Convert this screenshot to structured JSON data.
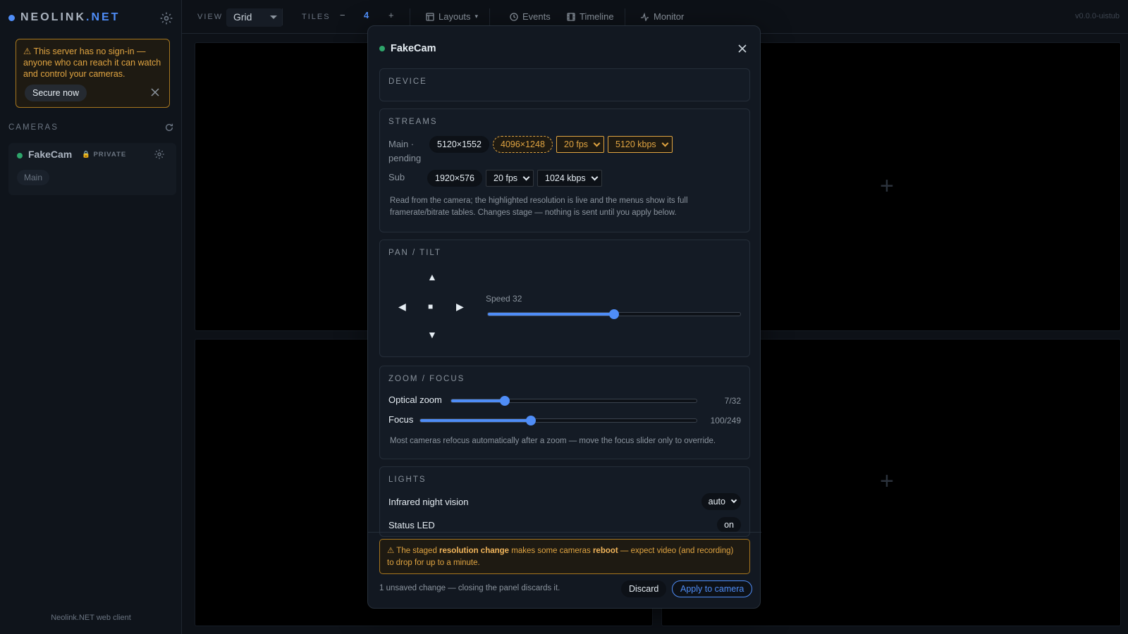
{
  "brand": {
    "name_a": "NEOLINK",
    "name_b": ".NET"
  },
  "sidebar": {
    "warning": {
      "text": "This server has no sign-in — anyone who can reach it can watch and control your cameras.",
      "secure_label": "Secure now"
    },
    "cameras_label": "CAMERAS",
    "camera": {
      "name": "FakeCam",
      "badge": "PRIVATE",
      "stream_chip": "Main"
    },
    "footer": "Neolink.NET web client"
  },
  "toolbar": {
    "view_label": "VIEW",
    "view_value": "Grid",
    "tiles_label": "TILES",
    "tiles_minus": "−",
    "tiles_count": "4",
    "tiles_plus": "+",
    "layouts": "Layouts",
    "events": "Events",
    "timeline": "Timeline",
    "monitor": "Monitor",
    "version": "v0.0.0-uistub"
  },
  "tiles": {
    "add_glyph": "+"
  },
  "modal": {
    "title": "FakeCam",
    "device_title": "DEVICE",
    "streams": {
      "title": "STREAMS",
      "main_label": "Main · pending",
      "main_res_live": "5120×1552",
      "main_res_staged": "4096×1248",
      "main_fps": "20 fps",
      "main_kbps": "5120 kbps",
      "sub_label": "Sub",
      "sub_res": "1920×576",
      "sub_fps": "20 fps",
      "sub_kbps": "1024 kbps",
      "note": "Read from the camera; the highlighted resolution is live and the menus show its full framerate/bitrate tables. Changes stage — nothing is sent until you apply below."
    },
    "pantilt": {
      "title": "PAN / TILT",
      "up": "▲",
      "down": "▼",
      "left": "◀",
      "right": "▶",
      "stop": "■",
      "speed_label": "Speed 32",
      "speed_value": 32,
      "speed_max": 64
    },
    "zoom": {
      "title": "ZOOM / FOCUS",
      "zoom_label": "Optical zoom",
      "zoom_value_text": "7/32",
      "zoom_value": 7,
      "zoom_max": 32,
      "focus_label": "Focus",
      "focus_value_text": "100/249",
      "focus_value": 100,
      "focus_max": 249,
      "note": "Most cameras refocus automatically after a zoom — move the focus slider only to override."
    },
    "lights": {
      "title": "LIGHTS",
      "ir_label": "Infrared night vision",
      "ir_value": "auto",
      "led_label": "Status LED",
      "led_value": "on"
    },
    "footer": {
      "warn_prefix": "⚠ The staged ",
      "warn_b1": "resolution change",
      "warn_mid": " makes some cameras ",
      "warn_b2": "reboot",
      "warn_suffix": " — expect video (and recording) to drop for up to a minute.",
      "unsaved": "1 unsaved change — closing the panel discards it.",
      "discard": "Discard",
      "apply": "Apply to camera"
    }
  },
  "colors": {
    "accent": "#4f8df7",
    "warning": "#e0a441",
    "online": "#2ea56b"
  }
}
